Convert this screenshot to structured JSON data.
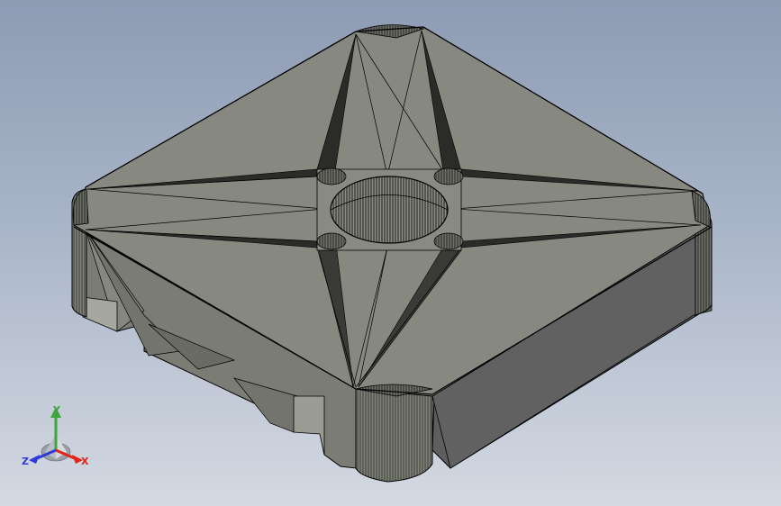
{
  "viewport": {
    "title": "",
    "background_top": "#8d9bb4",
    "background_bottom": "#d4d9e2"
  },
  "model": {
    "name": "",
    "face_top_color": "#878880",
    "face_side_left_color": "#7b7c74",
    "face_side_right_color": "#5e5e5e",
    "edge_color": "#000000"
  },
  "triad": {
    "x_label": "X",
    "y_label": "Y",
    "z_label": "Z",
    "x_color": "#e2231a",
    "y_color": "#3ca53c",
    "z_color": "#2f39d8",
    "icon": "coordinate-triad-icon"
  }
}
